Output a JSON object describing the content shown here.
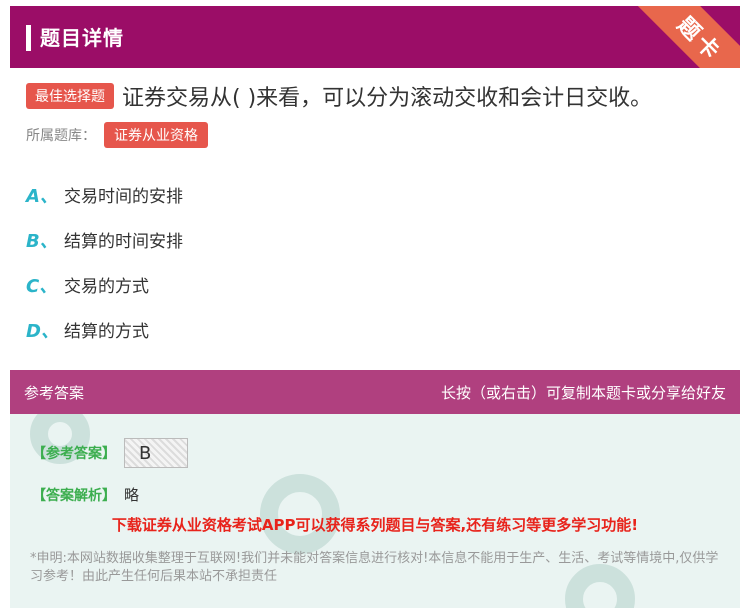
{
  "header": {
    "title": "题目详情",
    "corner_label": "题卡"
  },
  "question": {
    "type_tag": "最佳选择题",
    "text": "证券交易从( )来看，可以分为滚动交收和会计日交收。",
    "bank_label": "所属题库：",
    "bank_tag": "证券从业资格"
  },
  "options": [
    {
      "letter": "A、",
      "text": "交易时间的安排"
    },
    {
      "letter": "B、",
      "text": "结算的时间安排"
    },
    {
      "letter": "C、",
      "text": "交易的方式"
    },
    {
      "letter": "D、",
      "text": "结算的方式"
    }
  ],
  "answer": {
    "head_left": "参考答案",
    "head_right": "长按（或右击）可复制本题卡或分享给好友",
    "ref_label": "【参考答案】",
    "ref_value": "B",
    "analysis_label": "【答案解析】",
    "analysis_value": "略",
    "promo": "下载证券从业资格考试APP可以获得系列题目与答案,还有练习等更多学习功能!",
    "disclaimer": "*申明:本网站数据收集整理于互联网!我们并未能对答案信息进行核对!本信息不能用于生产、生活、考试等情境中,仅供学习参考！由此产生任何后果本站不承担责任"
  },
  "colors": {
    "header_bg": "#9b0d67",
    "accent_red": "#e6564c",
    "option_letter": "#2bb4c9",
    "answer_head_bg": "#b0407f",
    "promo": "#e8231b"
  }
}
